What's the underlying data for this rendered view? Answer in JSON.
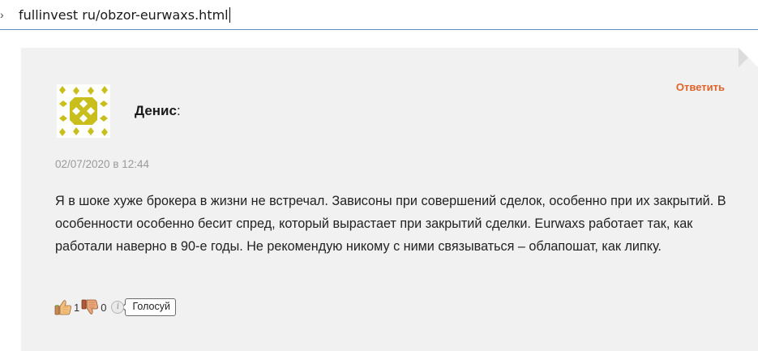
{
  "address_bar": {
    "url": "fullinvest ru/obzor-eurwaxs.html"
  },
  "comment": {
    "author": "Денис",
    "author_suffix": ":",
    "reply_label": "Ответить",
    "date": "02/07/2020 в 12:44",
    "text": "Я в шоке хуже брокера в жизни не встречал. Зависоны при совершений сделок, особенно при их закрытий. В особенности особенно бесит спред, который вырастает при закрытий сделки. Eurwaxs работает так, как работали наверно в 90-е годы. Не рекомендую никому с ними связываться – облапошат, как липку.",
    "votes": {
      "likes": "1",
      "dislikes": "0",
      "info_symbol": "i",
      "vote_button_label": "Голосуй"
    }
  },
  "colors": {
    "accent": "#e0632a",
    "card_background": "#f1f1f1",
    "avatar_pattern": "#c9bf1c",
    "address_border": "#5b8fc7"
  },
  "icons": {
    "avatar": "identicon-avatar",
    "like": "thumbs-up-icon",
    "dislike": "thumbs-down-icon",
    "info": "info-icon"
  }
}
